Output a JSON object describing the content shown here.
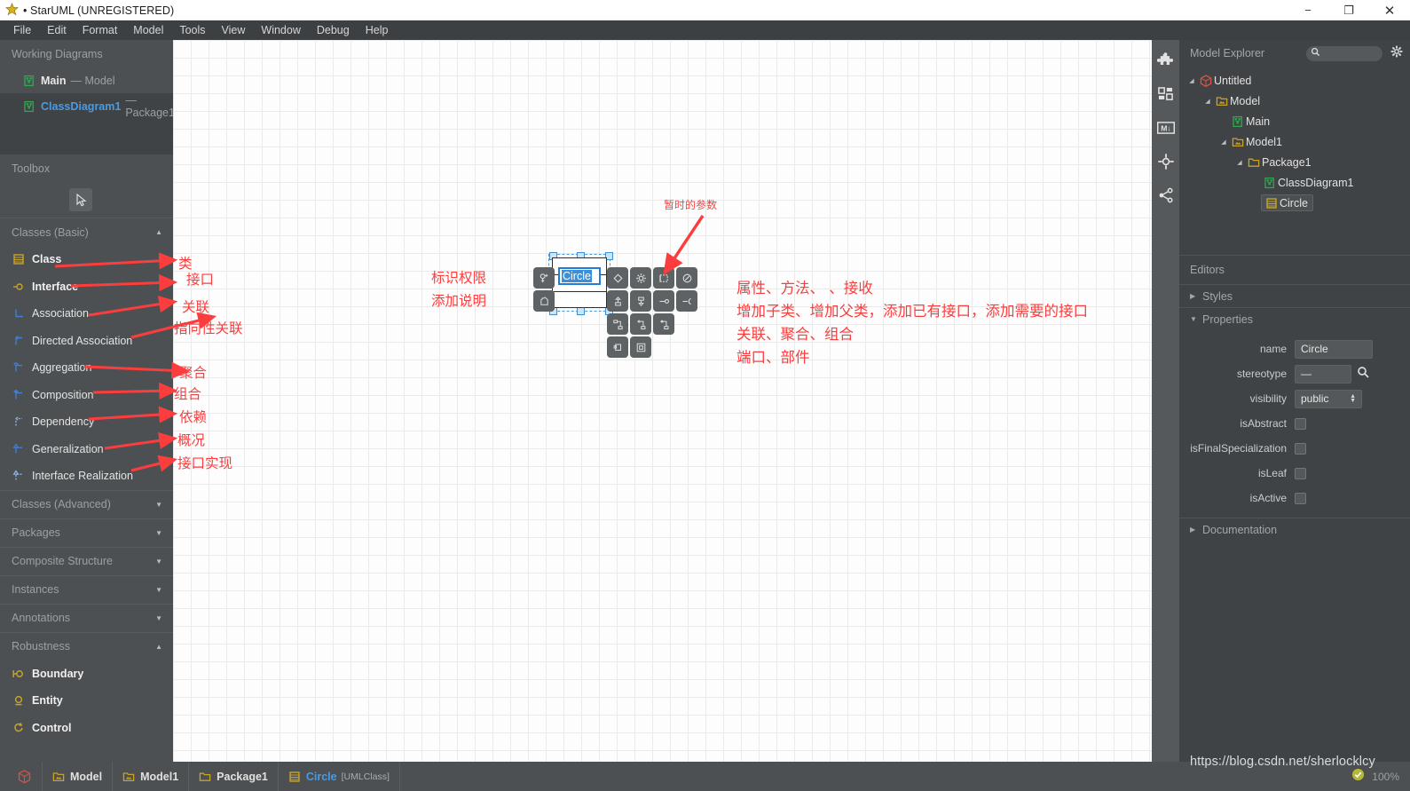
{
  "window": {
    "title": "• StarUML (UNREGISTERED)",
    "star_icon": "star-icon",
    "minimize": "−",
    "maximize": "❐",
    "close": "✕"
  },
  "menubar": {
    "items": [
      "File",
      "Edit",
      "Format",
      "Model",
      "Tools",
      "View",
      "Window",
      "Debug",
      "Help"
    ]
  },
  "sidebar": {
    "working_diagrams": {
      "header": "Working Diagrams",
      "items": [
        {
          "name": "Main",
          "sub": "— Model",
          "selected": false
        },
        {
          "name": "ClassDiagram1",
          "sub": "— Package1",
          "selected": true
        }
      ]
    },
    "toolbox": {
      "header": "Toolbox",
      "pointer_icon": "cursor-arrow-icon",
      "groups": [
        {
          "title": "Classes (Basic)",
          "expanded": true,
          "caret": "▲",
          "items": [
            {
              "label": "Class",
              "icon": "class-icon"
            },
            {
              "label": "Interface",
              "icon": "interface-icon"
            },
            {
              "label": "Association",
              "icon": "association-icon"
            },
            {
              "label": "Directed Association",
              "icon": "directed-association-icon"
            },
            {
              "label": "Aggregation",
              "icon": "aggregation-icon"
            },
            {
              "label": "Composition",
              "icon": "composition-icon"
            },
            {
              "label": "Dependency",
              "icon": "dependency-icon"
            },
            {
              "label": "Generalization",
              "icon": "generalization-icon"
            },
            {
              "label": "Interface Realization",
              "icon": "interface-realization-icon"
            }
          ]
        },
        {
          "title": "Classes (Advanced)",
          "expanded": false,
          "caret": "▼",
          "items": []
        },
        {
          "title": "Packages",
          "expanded": false,
          "caret": "▼",
          "items": []
        },
        {
          "title": "Composite Structure",
          "expanded": false,
          "caret": "▼",
          "items": []
        },
        {
          "title": "Instances",
          "expanded": false,
          "caret": "▼",
          "items": []
        },
        {
          "title": "Annotations",
          "expanded": false,
          "caret": "▼",
          "items": []
        },
        {
          "title": "Robustness",
          "expanded": true,
          "caret": "▲",
          "items": [
            {
              "label": "Boundary",
              "icon": "boundary-icon"
            },
            {
              "label": "Entity",
              "icon": "entity-icon"
            },
            {
              "label": "Control",
              "icon": "control-icon"
            }
          ]
        }
      ]
    }
  },
  "rail": {
    "icons": [
      "puzzle-icon",
      "layout-grid-icon",
      "markdown-icon",
      "target-icon",
      "share-icon"
    ]
  },
  "model_explorer": {
    "title": "Model Explorer",
    "search_placeholder": "",
    "search_icon": "search-icon",
    "gear_icon": "gear-icon",
    "tree": [
      {
        "label": "Untitled",
        "icon": "project-cube-icon",
        "depth": 0,
        "caret": "◢",
        "boxed": false
      },
      {
        "label": "Model",
        "icon": "model-folder-icon",
        "depth": 1,
        "caret": "◢",
        "boxed": false
      },
      {
        "label": "Main",
        "icon": "diagram-icon",
        "depth": 2,
        "caret": "",
        "boxed": false
      },
      {
        "label": "Model1",
        "icon": "model-folder-icon",
        "depth": 2,
        "caret": "◢",
        "boxed": false
      },
      {
        "label": "Package1",
        "icon": "package-icon",
        "depth": 3,
        "caret": "◢",
        "boxed": false
      },
      {
        "label": "ClassDiagram1",
        "icon": "diagram-icon",
        "depth": 4,
        "caret": "",
        "boxed": false
      },
      {
        "label": "Circle",
        "icon": "class-icon",
        "depth": 4,
        "caret": "",
        "boxed": true
      }
    ]
  },
  "editors": {
    "title": "Editors",
    "sections": [
      {
        "label": "Styles",
        "caret": "▶",
        "expanded": false
      },
      {
        "label": "Properties",
        "caret": "▼",
        "expanded": true
      },
      {
        "label": "Documentation",
        "caret": "▶",
        "expanded": false
      }
    ],
    "properties": [
      {
        "label": "name",
        "type": "text",
        "value": "Circle"
      },
      {
        "label": "stereotype",
        "type": "text-search",
        "value": "—"
      },
      {
        "label": "visibility",
        "type": "select",
        "value": "public"
      },
      {
        "label": "isAbstract",
        "type": "checkbox",
        "value": false
      },
      {
        "label": "isFinalSpecialization",
        "type": "checkbox",
        "value": false
      },
      {
        "label": "isLeaf",
        "type": "checkbox",
        "value": false
      },
      {
        "label": "isActive",
        "type": "checkbox",
        "value": false
      }
    ]
  },
  "canvas": {
    "class_element": {
      "name": "Circle",
      "editing": true
    },
    "quick_tools_left": [
      "add-attribute-icon",
      "add-operation-icon"
    ],
    "quick_tools_grid": [
      "tag-icon",
      "gear-icon",
      "note-icon",
      "copy-style-icon",
      "subclass-icon",
      "superclass-icon",
      "provided-interface-icon",
      "required-interface-icon",
      "association-icon",
      "aggregation-icon",
      "composition-icon",
      "port-icon",
      "part-icon"
    ]
  },
  "annotations": {
    "toolbox_labels": [
      {
        "text": "类",
        "for": "Class"
      },
      {
        "text": "接口",
        "for": "Interface"
      },
      {
        "text": "关联",
        "for": "Association"
      },
      {
        "text": "指向性关联",
        "for": "Directed Association"
      },
      {
        "text": "聚合",
        "for": "Aggregation"
      },
      {
        "text": "组合",
        "for": "Composition"
      },
      {
        "text": "依赖",
        "for": "Dependency"
      },
      {
        "text": "概况",
        "for": "Generalization"
      },
      {
        "text": "接口实现",
        "for": "Interface Realization"
      }
    ],
    "left_of_element": [
      "标识权限",
      "添加说明"
    ],
    "top_callout": "暂时的参数",
    "right_block": [
      "属性、方法、   、接收",
      "增加子类、增加父类，添加已有接口，添加需要的接口",
      "关联、聚合、组合",
      "端口、部件"
    ]
  },
  "statusbar": {
    "project_icon": "project-cube-icon",
    "items": [
      {
        "label": "Model",
        "icon": "model-folder-icon",
        "sub": "",
        "blue": false
      },
      {
        "label": "Model1",
        "icon": "model-folder-icon",
        "sub": "",
        "blue": false
      },
      {
        "label": "Package1",
        "icon": "package-icon",
        "sub": "",
        "blue": false
      },
      {
        "label": "Circle",
        "icon": "class-icon",
        "sub": "[UMLClass]",
        "blue": true
      }
    ],
    "zoom": "100%",
    "status_icon": "check-badge-icon"
  },
  "watermark": {
    "text": "https://blog.csdn.net/sherlocklcy"
  },
  "colors": {
    "sidebar_bg": "#4c5052",
    "panel_bg": "#3f4345",
    "menubar_bg": "#3c4043",
    "accent_blue": "#4a9ae1",
    "annotation_red": "#fc3d3d",
    "canvas_bg": "#fdfdfd",
    "grid_line": "#e9ebeb",
    "icon_gold": "#c9a227",
    "icon_green": "#2fa84f"
  }
}
